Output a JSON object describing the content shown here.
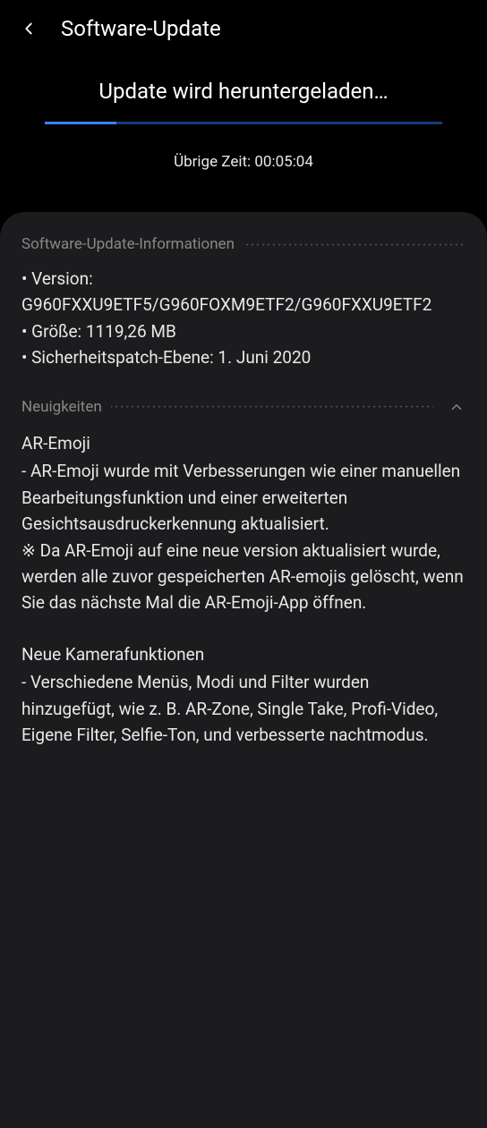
{
  "header": {
    "title": "Software-Update"
  },
  "download": {
    "status": "Update wird heruntergeladen…",
    "timeLabel": "Übrige Zeit: 00:05:04"
  },
  "info": {
    "sectionTitle": "Software-Update-Informationen",
    "version": "• Version: G960FXXU9ETF5/G960FOXM9ETF2/G960FXXU9ETF2",
    "size": "• Größe: 1119,26 MB",
    "securityPatch": "• Sicherheitspatch-Ebene: 1. Juni 2020"
  },
  "whatsNew": {
    "sectionTitle": "Neuigkeiten",
    "ar": {
      "title": "AR-Emoji",
      "body": "- AR-Emoji wurde mit Verbesserungen wie einer manuellen Bearbeitungsfunktion und einer erweiterten Gesichtsausdruckerkennung aktualisiert.\n※ Da AR-Emoji auf eine neue version aktualisiert wurde, werden alle zuvor gespeicherten AR-emojis gelöscht, wenn Sie das nächste Mal die AR-Emoji-App öffnen."
    },
    "camera": {
      "title": "Neue Kamerafunktionen",
      "body": "- Verschiedene Menüs, Modi und Filter wurden hinzugefügt, wie z. B. AR-Zone, Single Take, Profi-Video, Eigene Filter, Selfie-Ton, und verbesserte nachtmodus."
    }
  }
}
